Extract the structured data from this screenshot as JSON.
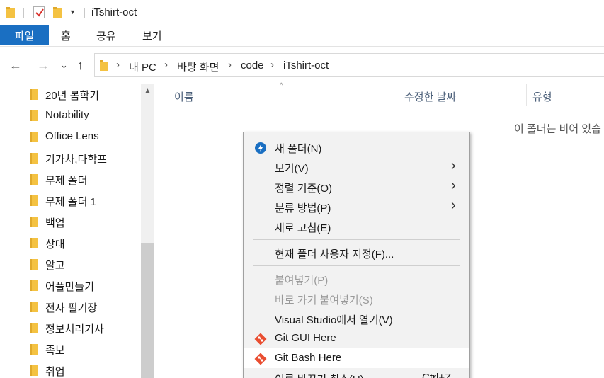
{
  "window": {
    "title": "iTshirt-oct"
  },
  "colors": {
    "folder": "#f4c242",
    "accent": "#1a6fc2",
    "git": "#e94e31"
  },
  "ribbon": {
    "file_tab": "파일",
    "tabs": [
      "홈",
      "공유",
      "보기"
    ]
  },
  "nav": {
    "back": "←",
    "forward": "→",
    "recent": "⌄",
    "up": "↑",
    "breadcrumb": [
      "내 PC",
      "바탕 화면",
      "code",
      "iTshirt-oct"
    ],
    "separator": "›"
  },
  "sidebar": {
    "items": [
      {
        "label": "20년 봄학기"
      },
      {
        "label": "Notability"
      },
      {
        "label": "Office Lens"
      },
      {
        "label": "기가차,다학프"
      },
      {
        "label": "무제 폴더"
      },
      {
        "label": "무제 폴더 1"
      },
      {
        "label": "백업"
      },
      {
        "label": "상대"
      },
      {
        "label": "알고"
      },
      {
        "label": "어플만들기"
      },
      {
        "label": "전자 필기장"
      },
      {
        "label": "정보처리기사"
      },
      {
        "label": "족보"
      },
      {
        "label": "취업"
      }
    ]
  },
  "main": {
    "columns": [
      "이름",
      "수정한 날짜",
      "유형"
    ],
    "sort_indicator": "^",
    "empty_message": "이 폴더는 비어 있습"
  },
  "context_menu": {
    "items": [
      {
        "label": "새 폴더(N)",
        "icon": "new-folder-icon"
      },
      {
        "label": "보기(V)",
        "submenu": "›"
      },
      {
        "label": "정렬 기준(O)",
        "submenu": "›"
      },
      {
        "label": "분류 방법(P)",
        "submenu": "›"
      },
      {
        "label": "새로 고침(E)"
      },
      {
        "label": "현재 폴더 사용자 지정(F)..."
      },
      {
        "label": "붙여넣기(P)",
        "disabled": true
      },
      {
        "label": "바로 가기 붙여넣기(S)",
        "disabled": true
      },
      {
        "label": "Visual Studio에서 열기(V)"
      },
      {
        "label": "Git GUI Here",
        "icon": "git-icon"
      },
      {
        "label": "Git Bash Here",
        "icon": "git-icon"
      },
      {
        "label": "이름 바꾸기 취소(U)",
        "shortcut": "Ctrl+Z"
      }
    ]
  }
}
